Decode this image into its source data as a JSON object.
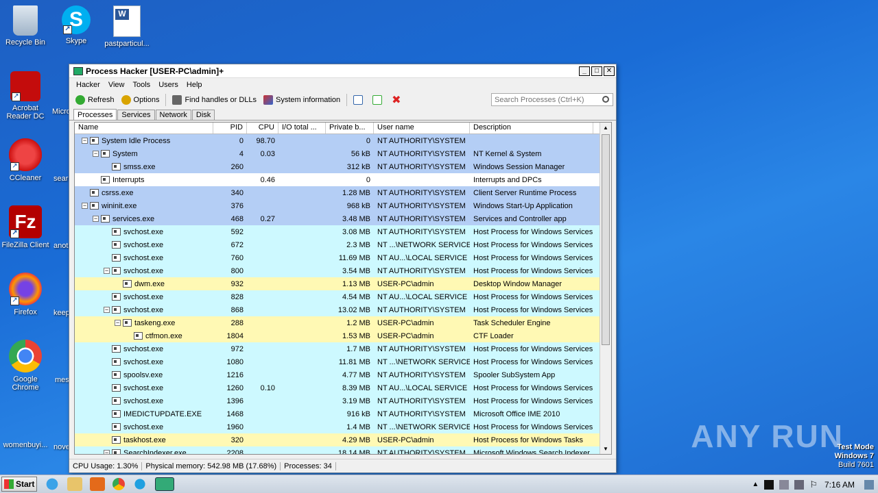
{
  "desktop": {
    "icons": [
      {
        "label": "Recycle Bin"
      },
      {
        "label": "Skype"
      },
      {
        "label": "pastparticul..."
      },
      {
        "label": "Acrobat Reader DC"
      },
      {
        "label": "CCleaner"
      },
      {
        "label": "FileZilla Client"
      },
      {
        "label": "Firefox"
      },
      {
        "label": "Google Chrome"
      },
      {
        "label": "womenbuyi..."
      }
    ],
    "partial_labels": [
      "Micro",
      "sear",
      "anot",
      "keep",
      "mes",
      "nove"
    ]
  },
  "window": {
    "title": "Process Hacker [USER-PC\\admin]+",
    "menu": [
      "Hacker",
      "View",
      "Tools",
      "Users",
      "Help"
    ],
    "toolbar": {
      "refresh": "Refresh",
      "options": "Options",
      "find": "Find handles or DLLs",
      "sysinfo": "System information"
    },
    "search_placeholder": "Search Processes (Ctrl+K)",
    "tabs": [
      "Processes",
      "Services",
      "Network",
      "Disk"
    ],
    "columns": [
      "Name",
      "PID",
      "CPU",
      "I/O total ...",
      "Private b...",
      "User name",
      "Description"
    ],
    "processes": [
      {
        "name": "System Idle Process",
        "indent": 0,
        "exp": "−",
        "pid": "0",
        "cpu": "98.70",
        "priv": "0",
        "user": "NT AUTHORITY\\SYSTEM",
        "desc": "",
        "color": "blue"
      },
      {
        "name": "System",
        "indent": 1,
        "exp": "−",
        "pid": "4",
        "cpu": "0.03",
        "priv": "56 kB",
        "user": "NT AUTHORITY\\SYSTEM",
        "desc": "NT Kernel & System",
        "color": "blue"
      },
      {
        "name": "smss.exe",
        "indent": 2,
        "exp": "",
        "pid": "260",
        "cpu": "",
        "priv": "312 kB",
        "user": "NT AUTHORITY\\SYSTEM",
        "desc": "Windows Session Manager",
        "color": "blue"
      },
      {
        "name": "Interrupts",
        "indent": 1,
        "exp": "",
        "pid": "",
        "cpu": "0.46",
        "priv": "0",
        "user": "",
        "desc": "Interrupts and DPCs",
        "color": "white"
      },
      {
        "name": "csrss.exe",
        "indent": 0,
        "exp": "",
        "pid": "340",
        "cpu": "",
        "priv": "1.28 MB",
        "user": "NT AUTHORITY\\SYSTEM",
        "desc": "Client Server Runtime Process",
        "color": "blue"
      },
      {
        "name": "wininit.exe",
        "indent": 0,
        "exp": "−",
        "pid": "376",
        "cpu": "",
        "priv": "968 kB",
        "user": "NT AUTHORITY\\SYSTEM",
        "desc": "Windows Start-Up Application",
        "color": "blue"
      },
      {
        "name": "services.exe",
        "indent": 1,
        "exp": "−",
        "pid": "468",
        "cpu": "0.27",
        "priv": "3.48 MB",
        "user": "NT AUTHORITY\\SYSTEM",
        "desc": "Services and Controller app",
        "color": "blue"
      },
      {
        "name": "svchost.exe",
        "indent": 2,
        "exp": "",
        "pid": "592",
        "cpu": "",
        "priv": "3.08 MB",
        "user": "NT AUTHORITY\\SYSTEM",
        "desc": "Host Process for Windows Services",
        "color": "cyan"
      },
      {
        "name": "svchost.exe",
        "indent": 2,
        "exp": "",
        "pid": "672",
        "cpu": "",
        "priv": "2.3 MB",
        "user": "NT ...\\NETWORK SERVICE",
        "desc": "Host Process for Windows Services",
        "color": "cyan"
      },
      {
        "name": "svchost.exe",
        "indent": 2,
        "exp": "",
        "pid": "760",
        "cpu": "",
        "priv": "11.69 MB",
        "user": "NT AU...\\LOCAL SERVICE",
        "desc": "Host Process for Windows Services",
        "color": "cyan"
      },
      {
        "name": "svchost.exe",
        "indent": 2,
        "exp": "−",
        "pid": "800",
        "cpu": "",
        "priv": "3.54 MB",
        "user": "NT AUTHORITY\\SYSTEM",
        "desc": "Host Process for Windows Services",
        "color": "cyan"
      },
      {
        "name": "dwm.exe",
        "indent": 3,
        "exp": "",
        "pid": "932",
        "cpu": "",
        "priv": "1.13 MB",
        "user": "USER-PC\\admin",
        "desc": "Desktop Window Manager",
        "color": "yellow"
      },
      {
        "name": "svchost.exe",
        "indent": 2,
        "exp": "",
        "pid": "828",
        "cpu": "",
        "priv": "4.54 MB",
        "user": "NT AU...\\LOCAL SERVICE",
        "desc": "Host Process for Windows Services",
        "color": "cyan"
      },
      {
        "name": "svchost.exe",
        "indent": 2,
        "exp": "−",
        "pid": "868",
        "cpu": "",
        "priv": "13.02 MB",
        "user": "NT AUTHORITY\\SYSTEM",
        "desc": "Host Process for Windows Services",
        "color": "cyan"
      },
      {
        "name": "taskeng.exe",
        "indent": 3,
        "exp": "−",
        "pid": "288",
        "cpu": "",
        "priv": "1.2 MB",
        "user": "USER-PC\\admin",
        "desc": "Task Scheduler Engine",
        "color": "yellow"
      },
      {
        "name": "ctfmon.exe",
        "indent": 4,
        "exp": "",
        "pid": "1804",
        "cpu": "",
        "priv": "1.53 MB",
        "user": "USER-PC\\admin",
        "desc": "CTF Loader",
        "color": "yellow"
      },
      {
        "name": "svchost.exe",
        "indent": 2,
        "exp": "",
        "pid": "972",
        "cpu": "",
        "priv": "1.7 MB",
        "user": "NT AUTHORITY\\SYSTEM",
        "desc": "Host Process for Windows Services",
        "color": "cyan"
      },
      {
        "name": "svchost.exe",
        "indent": 2,
        "exp": "",
        "pid": "1080",
        "cpu": "",
        "priv": "11.81 MB",
        "user": "NT ...\\NETWORK SERVICE",
        "desc": "Host Process for Windows Services",
        "color": "cyan"
      },
      {
        "name": "spoolsv.exe",
        "indent": 2,
        "exp": "",
        "pid": "1216",
        "cpu": "",
        "priv": "4.77 MB",
        "user": "NT AUTHORITY\\SYSTEM",
        "desc": "Spooler SubSystem App",
        "color": "cyan"
      },
      {
        "name": "svchost.exe",
        "indent": 2,
        "exp": "",
        "pid": "1260",
        "cpu": "0.10",
        "priv": "8.39 MB",
        "user": "NT AU...\\LOCAL SERVICE",
        "desc": "Host Process for Windows Services",
        "color": "cyan"
      },
      {
        "name": "svchost.exe",
        "indent": 2,
        "exp": "",
        "pid": "1396",
        "cpu": "",
        "priv": "3.19 MB",
        "user": "NT AUTHORITY\\SYSTEM",
        "desc": "Host Process for Windows Services",
        "color": "cyan"
      },
      {
        "name": "IMEDICTUPDATE.EXE",
        "indent": 2,
        "exp": "",
        "pid": "1468",
        "cpu": "",
        "priv": "916 kB",
        "user": "NT AUTHORITY\\SYSTEM",
        "desc": "Microsoft Office IME 2010",
        "color": "cyan"
      },
      {
        "name": "svchost.exe",
        "indent": 2,
        "exp": "",
        "pid": "1960",
        "cpu": "",
        "priv": "1.4 MB",
        "user": "NT ...\\NETWORK SERVICE",
        "desc": "Host Process for Windows Services",
        "color": "cyan"
      },
      {
        "name": "taskhost.exe",
        "indent": 2,
        "exp": "",
        "pid": "320",
        "cpu": "",
        "priv": "4.29 MB",
        "user": "USER-PC\\admin",
        "desc": "Host Process for Windows Tasks",
        "color": "yellow"
      },
      {
        "name": "SearchIndexer.exe",
        "indent": 2,
        "exp": "−",
        "pid": "2208",
        "cpu": "",
        "priv": "18.14 MB",
        "user": "NT AUTHORITY\\SYSTEM",
        "desc": "Microsoft Windows Search Indexer",
        "color": "cyan"
      }
    ],
    "status": {
      "cpu": "CPU Usage: 1.30%",
      "mem": "Physical memory: 542.98 MB (17.68%)",
      "procs": "Processes: 34"
    }
  },
  "taskbar": {
    "start": "Start",
    "clock": "7:16 AM"
  },
  "watermark": "ANY RUN",
  "test_mode": {
    "line1": "Test Mode",
    "line2": "Windows 7",
    "line3": "Build 7601"
  }
}
